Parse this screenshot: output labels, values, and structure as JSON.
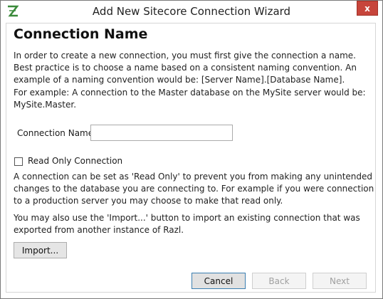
{
  "window": {
    "title": "Add New Sitecore Connection Wizard",
    "close_label": "x"
  },
  "page": {
    "title": "Connection Name",
    "intro": "In order to create a new connection, you must first give the connection a name. Best practice is to choose a name based on a consistent naming convention. An example of a naming convention would be: [Server Name].[Database Name].",
    "example": "For example: A connection to the Master database on the MySite server would be: MySite.Master.",
    "connection_name": {
      "label": "Connection Name:",
      "value": "",
      "placeholder": ""
    },
    "read_only": {
      "label": "Read Only Connection",
      "checked": false,
      "description": "A connection can be set as 'Read Only' to prevent you from making any unintended changes to the database you are connecting to. For example if you were connection to a production server you may choose to make that read only."
    },
    "import_note": "You may also use the 'Import...' button to import an existing connection that was exported from another instance of Razl.",
    "import_label": "Import..."
  },
  "buttons": {
    "cancel": "Cancel",
    "back": "Back",
    "next": "Next"
  },
  "colors": {
    "close_button": "#c7453b",
    "app_icon": "#3a8a3a"
  }
}
